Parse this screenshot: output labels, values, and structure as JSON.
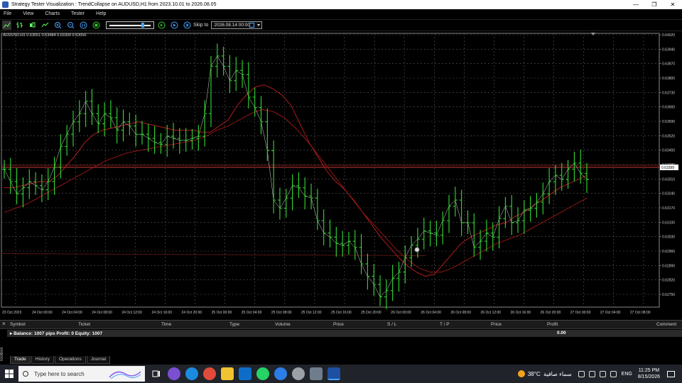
{
  "window": {
    "title": "Strategy Tester Visualization : TrendCollapse on AUDUSD,H1 from 2023.10.01 to 2026.08.05",
    "minimize": "—",
    "maximize": "❐",
    "close": "✕"
  },
  "menu": [
    "File",
    "View",
    "Charts",
    "Tester",
    "Help"
  ],
  "toolbar": {
    "skip_label": "Skip to",
    "skip_date": "2026.08.14 00:00",
    "speed_fraction": 0.8
  },
  "chart": {
    "symbol_line": "AUDUSD,H1  0.63051 0.63484 0.63300 0.63056",
    "price_labels": [
      "0.64020",
      "0.63940",
      "0.63870",
      "0.63800",
      "0.63730",
      "0.63660",
      "0.63590",
      "0.63520",
      "0.63450",
      "0.63380",
      "0.63310",
      "0.63240",
      "0.63170",
      "0.63100",
      "0.63030",
      "0.62960",
      "0.62890",
      "0.62820",
      "0.62750"
    ],
    "current_price": "0.63399",
    "time_labels": [
      "23 Oct 2023",
      "24 Oct 00:00",
      "24 Oct 04:00",
      "24 Oct 08:00",
      "24 Oct 12:00",
      "24 Oct 16:00",
      "24 Oct 20:00",
      "25 Oct 00:00",
      "25 Oct 04:00",
      "25 Oct 08:00",
      "25 Oct 12:00",
      "25 Oct 16:00",
      "25 Oct 20:00",
      "26 Oct 00:00",
      "26 Oct 04:00",
      "26 Oct 08:00",
      "26 Oct 12:00",
      "26 Oct 16:00",
      "26 Oct 20:00",
      "27 Oct 00:00",
      "27 Oct 04:00",
      "27 Oct 08:00"
    ],
    "colors": {
      "grid": "#5a5a5a",
      "bars": "#33dd33",
      "ma": "#c0201e",
      "hline": "#d03a3a"
    }
  },
  "chart_data": {
    "type": "ohlc",
    "ylim": [
      0.6272,
      0.6405
    ],
    "current_price": 0.63399,
    "closes": [
      0.6339,
      0.6333,
      0.6327,
      0.633,
      0.6333,
      0.6331,
      0.6329,
      0.6333,
      0.634,
      0.635,
      0.6356,
      0.6362,
      0.6366,
      0.6372,
      0.6366,
      0.6361,
      0.6366,
      0.6364,
      0.6358,
      0.6362,
      0.636,
      0.6356,
      0.6356,
      0.6354,
      0.6352,
      0.6351,
      0.6355,
      0.6354,
      0.6353,
      0.6353,
      0.6354,
      0.6355,
      0.6366,
      0.6389,
      0.6394,
      0.6389,
      0.6382,
      0.6387,
      0.6385,
      0.6374,
      0.6369,
      0.6362,
      0.6348,
      0.6324,
      0.632,
      0.6325,
      0.6331,
      0.633,
      0.6326,
      0.6325,
      0.6314,
      0.6308,
      0.6306,
      0.6303,
      0.6302,
      0.6304,
      0.6301,
      0.6293,
      0.6287,
      0.6283,
      0.6277,
      0.628,
      0.6286,
      0.6289,
      0.6296,
      0.6302,
      0.6305,
      0.6309,
      0.6308,
      0.6307,
      0.6314,
      0.6321,
      0.6324,
      0.6313,
      0.6313,
      0.6301,
      0.6304,
      0.6308,
      0.6306,
      0.6315,
      0.6321,
      0.6313,
      0.6314,
      0.6319,
      0.632,
      0.6323,
      0.6327,
      0.6333,
      0.6336,
      0.6334,
      0.6339,
      0.6342,
      0.6337,
      0.6334
    ],
    "ma_fast": [
      0.633,
      0.633,
      0.6331,
      0.6332,
      0.6333,
      0.6333,
      0.6336,
      0.6341,
      0.6346,
      0.6352,
      0.6356,
      0.6358,
      0.6359,
      0.636,
      0.6361,
      0.6362,
      0.6361,
      0.636,
      0.6359,
      0.6358,
      0.6358,
      0.6358,
      0.6357,
      0.6357,
      0.636,
      0.6363,
      0.637,
      0.6375,
      0.6379,
      0.638,
      0.6378,
      0.6375,
      0.637,
      0.6361,
      0.6352,
      0.6345,
      0.6338,
      0.6333,
      0.6329,
      0.6324,
      0.6318,
      0.6312,
      0.6306,
      0.6301,
      0.6296,
      0.6292,
      0.6289,
      0.6287,
      0.6288,
      0.6293,
      0.6298,
      0.6303,
      0.6306,
      0.6308,
      0.631,
      0.6312,
      0.6313,
      0.6316,
      0.6318,
      0.6321,
      0.6324,
      0.6327,
      0.633,
      0.6332,
      0.6334,
      0.6336
    ],
    "ma_slow": [
      0.6318,
      0.632,
      0.6322,
      0.6325,
      0.6328,
      0.6331,
      0.6334,
      0.6337,
      0.634,
      0.6343,
      0.6345,
      0.6347,
      0.6348,
      0.6349,
      0.635,
      0.6351,
      0.6352,
      0.6353,
      0.6355,
      0.6358,
      0.636,
      0.6363,
      0.6366,
      0.6368,
      0.6367,
      0.6364,
      0.6359,
      0.6353,
      0.6346,
      0.6339,
      0.6332,
      0.6325,
      0.6318,
      0.6312,
      0.6306,
      0.63,
      0.6295,
      0.6291,
      0.6289,
      0.6289,
      0.6291,
      0.6294,
      0.6297,
      0.63,
      0.6303,
      0.6305,
      0.6307,
      0.631,
      0.6313,
      0.6316,
      0.6319,
      0.6322,
      0.6325
    ]
  },
  "terminal": {
    "columns": [
      "Symbol",
      "Ticket",
      "Time",
      "Type",
      "Volume",
      "Price",
      "S / L",
      "T / P",
      "Price",
      "Profit",
      "Comment"
    ],
    "balance_text": "Balance: 1007 pips   Profit: 0   Equity: 1007",
    "profit_total": "0.00",
    "tabs": [
      "Trade",
      "History",
      "Operations",
      "Journal"
    ],
    "toolbox": "Toolbox"
  },
  "taskbar": {
    "search_placeholder": "Type here to search",
    "weather_temp": "38°C",
    "weather_text": "سماء صافية",
    "lang": "ENG",
    "time": "11:25 PM",
    "date": "8/15/2026"
  }
}
